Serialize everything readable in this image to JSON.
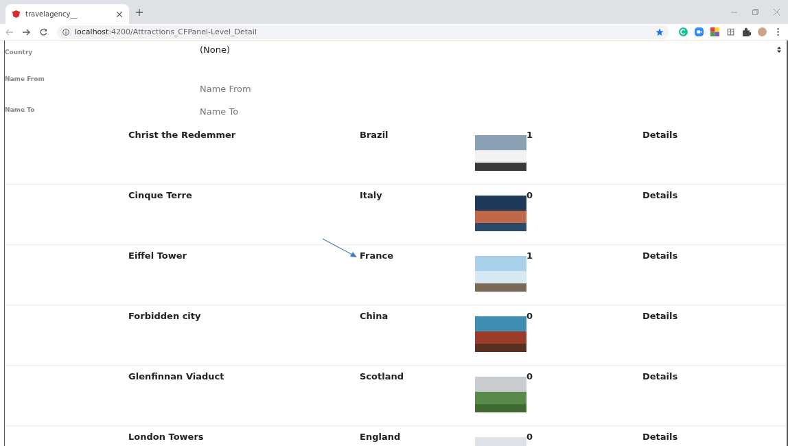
{
  "browser": {
    "tab_title": "travelagency__",
    "url": "**localhost**:4200/Attractions_CFPanel-Level_Detail"
  },
  "filters": [
    {
      "kind": "select",
      "label": "Country",
      "value": "(None)"
    },
    {
      "kind": "input",
      "label": "Name From",
      "placeholder": "Name From"
    },
    {
      "kind": "input",
      "label": "Name To",
      "placeholder": "Name To"
    }
  ],
  "attractions": [
    {
      "name": "Christ the Redemmer",
      "country": "Brazil",
      "count": "1",
      "link": "Details"
    },
    {
      "name": "Cinque Terre",
      "country": "Italy",
      "count": "0",
      "link": "Details"
    },
    {
      "name": "Eiffel Tower",
      "country": "France",
      "count": "1",
      "link": "Details"
    },
    {
      "name": "Forbidden city",
      "country": "China",
      "count": "0",
      "link": "Details"
    },
    {
      "name": "Glenfinnan Viaduct",
      "country": "Scotland",
      "count": "0",
      "link": "Details"
    },
    {
      "name": "London Towers",
      "country": "England",
      "count": "0",
      "link": "Details"
    }
  ]
}
